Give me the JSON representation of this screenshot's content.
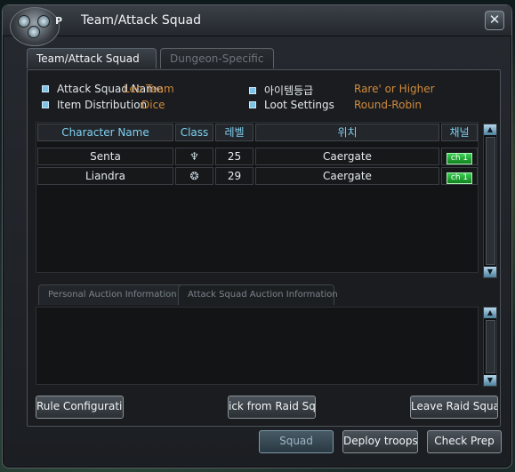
{
  "window": {
    "title": "Team/Attack Squad",
    "emblem_letter": "P"
  },
  "tabs": [
    {
      "label": "Team/Attack Squad",
      "active": true
    },
    {
      "label": "Dungeon-Specific",
      "active": false
    }
  ],
  "info": {
    "attack_squad_name_label": "Attack Squad Name",
    "attack_squad_name_value": "Leo Team",
    "item_grade_label": "아이템등급",
    "item_grade_value": "Rare' or Higher",
    "item_distribution_label": "Item Distribution",
    "item_distribution_value": "Dice",
    "loot_settings_label": "Loot Settings",
    "loot_settings_value": "Round-Robin"
  },
  "table": {
    "headers": [
      "Character Name",
      "Class",
      "레벨",
      "위치",
      "채널"
    ],
    "rows": [
      {
        "name": "Senta",
        "class_icon": "class-icon-a",
        "level": "25",
        "location": "Caergate",
        "channel": "ch 1"
      },
      {
        "name": "Liandra",
        "class_icon": "class-icon-b",
        "level": "29",
        "location": "Caergate",
        "channel": "ch 1"
      }
    ]
  },
  "auction_tabs": [
    {
      "label": "Personal Auction Information",
      "active": true
    },
    {
      "label": "Attack Squad Auction Information",
      "active": false
    }
  ],
  "buttons": {
    "rule_configuration": "Rule Configuration",
    "kick_from_raid": "ick from Raid Squa",
    "leave_raid": "Leave Raid Squad",
    "squad": "Squad",
    "deploy_troops": "Deploy troops",
    "check_prep": "Check Prep"
  },
  "colors": {
    "accent": "#7fd0ef",
    "value_orange": "#d08a3c",
    "channel_green": "#2bb845"
  }
}
